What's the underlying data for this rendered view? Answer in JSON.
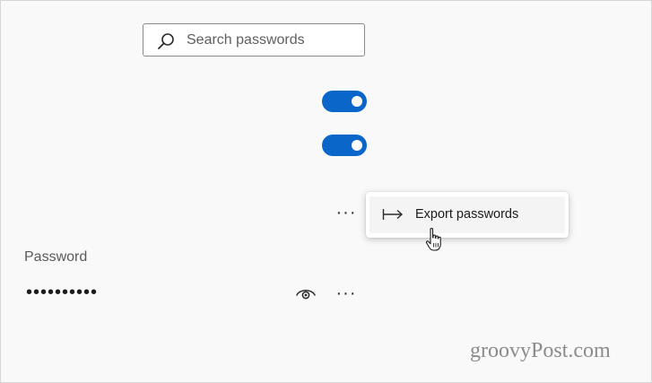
{
  "search": {
    "placeholder": "Search passwords",
    "value": "",
    "icon": "search-icon"
  },
  "toggles": [
    {
      "state": "on",
      "color": "#0a66c8"
    },
    {
      "state": "on",
      "color": "#0a66c8"
    }
  ],
  "menu": {
    "more_label": "···",
    "items": [
      {
        "label": "Export passwords",
        "icon": "export-arrow-icon"
      }
    ]
  },
  "password_section": {
    "heading": "Password",
    "masked_value": "••••••••••",
    "reveal_icon": "eye-icon",
    "more_label": "···"
  },
  "watermark": {
    "text": "groovyPost.com"
  },
  "colors": {
    "accent": "#0a66c8",
    "background": "#f9f9f9"
  }
}
